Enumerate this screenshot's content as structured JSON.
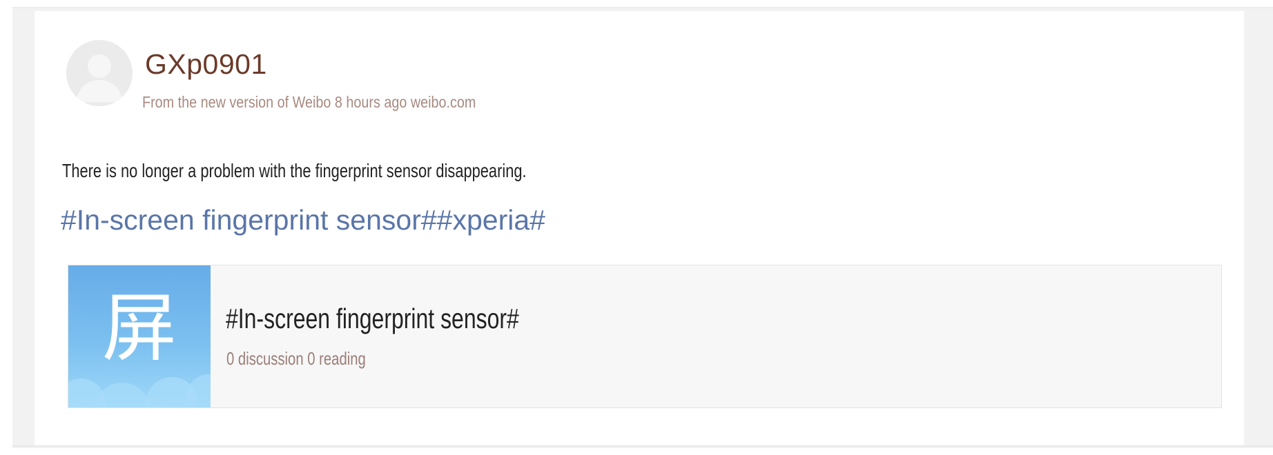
{
  "post": {
    "username": "GXp0901",
    "meta": "From the new version of Weibo 8 hours ago weibo.com",
    "text": "There is no longer a problem with the fingerprint sensor disappearing.",
    "hashtags": "#In-screen fingerprint sensor##xperia#"
  },
  "topic_card": {
    "thumb_char": "屏",
    "title": "#In-screen fingerprint sensor#",
    "stats": "0 discussion 0 reading"
  },
  "icons": {
    "avatar": "default-user-silhouette-icon"
  },
  "colors": {
    "username": "#6b3a2a",
    "meta": "#a88a80",
    "hashtag": "#5a75a8",
    "thumb_top": "#66ace8",
    "thumb_bottom": "#9fd8f8"
  }
}
